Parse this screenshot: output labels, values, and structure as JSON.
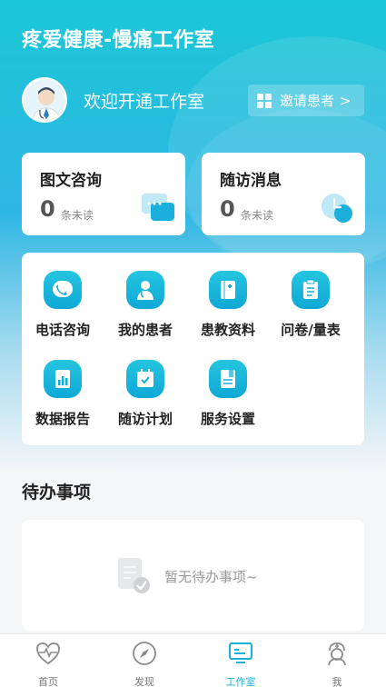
{
  "header": {
    "title": "疼爱健康-慢痛工作室",
    "welcome": "欢迎开通工作室",
    "invite_label": "邀请患者",
    "invite_chevron": ">"
  },
  "cards": [
    {
      "title": "图文咨询",
      "count": "0",
      "unread_label": "条未读",
      "icon": "chat-bubble-icon"
    },
    {
      "title": "随访消息",
      "count": "0",
      "unread_label": "条未读",
      "icon": "clock-icon"
    }
  ],
  "menu": {
    "items": [
      {
        "label": "电话咨询",
        "icon": "phone-icon"
      },
      {
        "label": "我的患者",
        "icon": "patients-icon"
      },
      {
        "label": "患教资料",
        "icon": "book-icon"
      },
      {
        "label": "问卷/量表",
        "icon": "clipboard-icon"
      },
      {
        "label": "数据报告",
        "icon": "report-chart-icon"
      },
      {
        "label": "随访计划",
        "icon": "calendar-icon"
      },
      {
        "label": "服务设置",
        "icon": "document-settings-icon"
      }
    ]
  },
  "todo": {
    "section_title": "待办事项",
    "empty_text": "暂无待办事项~"
  },
  "tabbar": {
    "items": [
      {
        "label": "首页",
        "icon": "heartbeat-icon",
        "active": false
      },
      {
        "label": "发现",
        "icon": "compass-icon",
        "active": false
      },
      {
        "label": "工作室",
        "icon": "workstation-icon",
        "active": true
      },
      {
        "label": "我",
        "icon": "nurse-icon",
        "active": false
      }
    ]
  },
  "colors": {
    "accent": "#1ab0db",
    "hero_top": "#1bc7d6",
    "hero_mid": "#2eb6e3",
    "background": "#f5f6f8"
  }
}
